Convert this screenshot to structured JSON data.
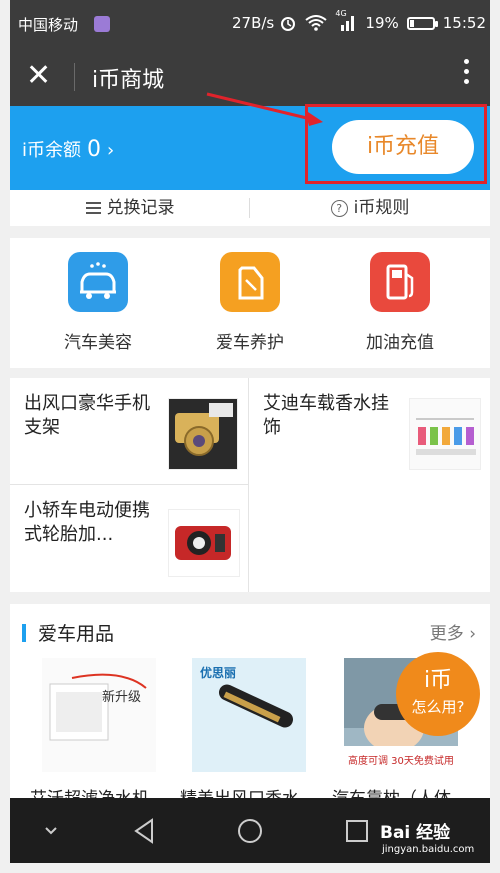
{
  "status_bar": {
    "carrier": "中国移动",
    "network_speed": "27B/s",
    "signal_tag": "4G",
    "battery": "19%",
    "time": "15:52"
  },
  "title_bar": {
    "close_icon": "close-icon",
    "title": "i币商城",
    "more_icon": "more-vertical-icon"
  },
  "balance": {
    "label": "i币余额",
    "amount": "0",
    "arrow": "›",
    "recharge_button": "i币充值",
    "highlight_color": "#e0232b"
  },
  "links": {
    "records": "兑换记录",
    "rules": "i币规则"
  },
  "categories": [
    {
      "label": "汽车美容",
      "icon": "car-wash-icon",
      "color": "#2f9ce8"
    },
    {
      "label": "爱车养护",
      "icon": "oil-can-icon",
      "color": "#f5a021"
    },
    {
      "label": "加油充值",
      "icon": "fuel-pump-icon",
      "color": "#e9493d"
    }
  ],
  "featured": [
    {
      "name": "出风口豪华手机支架"
    },
    {
      "name": "艾迪车载香水挂饰"
    },
    {
      "name": "小轿车电动便携式轮胎加..."
    }
  ],
  "section": {
    "title": "爱车用品",
    "more": "更多",
    "products": [
      {
        "name": "艾沃超滤净水机"
      },
      {
        "name": "精美出风口香水"
      },
      {
        "name": "汽车靠枕（人体"
      }
    ],
    "product_image_texts": [
      "新升级",
      "优思丽",
      "高度可调 30天免费试用"
    ]
  },
  "help_badge": {
    "line1": "i币",
    "line2": "怎么用?"
  },
  "navigation": {
    "back_icon": "back-triangle-icon",
    "home_icon": "home-circle-icon",
    "recent_icon": "recent-square-icon",
    "collapse_icon": "chevron-down-icon"
  },
  "watermark": {
    "brand": "Bai 经验",
    "url": "jingyan.baidu.com"
  },
  "colors": {
    "accent_blue": "#1da0ef",
    "accent_orange": "#f08a1b",
    "dark_bar": "#3c3c3c"
  }
}
